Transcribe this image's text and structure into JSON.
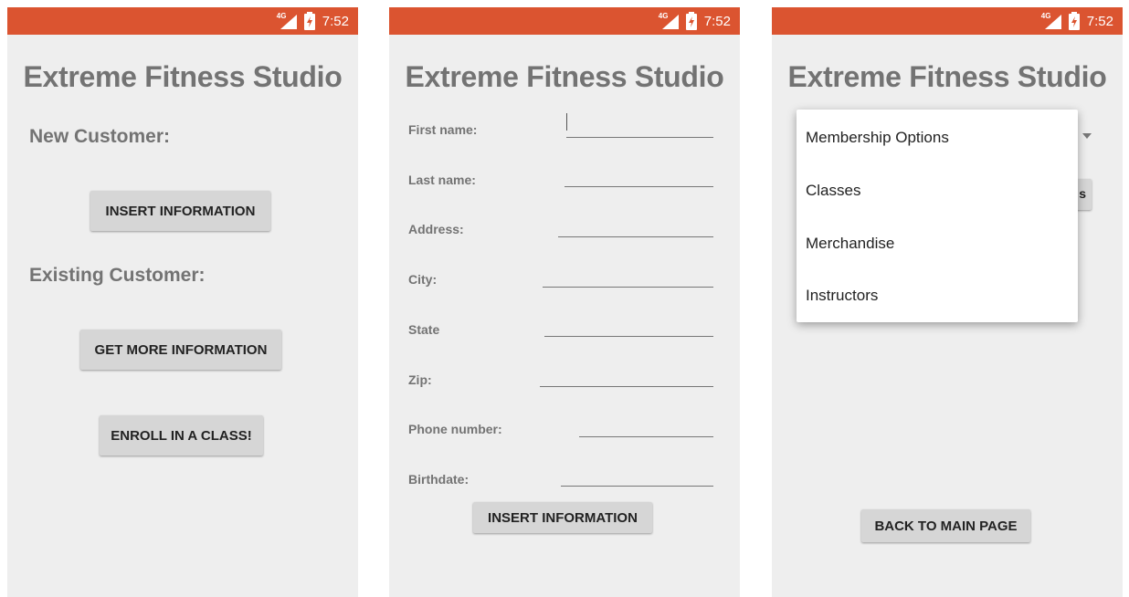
{
  "status": {
    "network": "4G",
    "time": "7:52"
  },
  "app_title": "Extreme Fitness Studio",
  "screen1": {
    "new_customer_label": "New Customer:",
    "insert_button": "INSERT INFORMATION",
    "existing_customer_label": "Existing Customer:",
    "more_info_button": "GET MORE INFORMATION",
    "enroll_button": "ENROLL IN A CLASS!"
  },
  "screen2": {
    "fields": [
      {
        "label": "First name:",
        "value": ""
      },
      {
        "label": "Last name:",
        "value": ""
      },
      {
        "label": "Address:",
        "value": ""
      },
      {
        "label": "City:",
        "value": ""
      },
      {
        "label": "State",
        "value": ""
      },
      {
        "label": "Zip:",
        "value": ""
      },
      {
        "label": "Phone number:",
        "value": ""
      },
      {
        "label": "Birthdate:",
        "value": ""
      }
    ],
    "submit_button": "INSERT INFORMATION"
  },
  "screen3": {
    "dropdown_options": [
      "Membership Options",
      "Classes",
      "Merchandise",
      "Instructors"
    ],
    "behind_button_fragment": "s",
    "back_button": "BACK TO MAIN PAGE"
  },
  "colors": {
    "status_bar": "#db5430",
    "background": "#eeeeee",
    "button": "#d6d6d6",
    "label": "#737373"
  },
  "icons": [
    "signal-icon",
    "battery-charging-icon",
    "dropdown-arrow-icon"
  ]
}
